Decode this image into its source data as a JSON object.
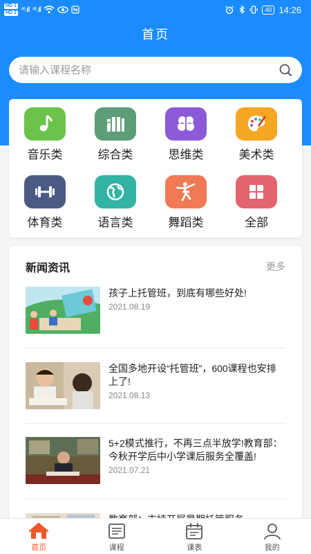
{
  "status_bar": {
    "hd1": "HD 1",
    "hd2": "HD 2",
    "signal1": "⁴⁶.ıll",
    "signal2": "⁴⁶.ıll",
    "battery": "40",
    "time": "14:26"
  },
  "header": {
    "title": "首页"
  },
  "search": {
    "placeholder": "请输入课程名称",
    "value": ""
  },
  "categories": [
    {
      "label": "音乐类",
      "color": "#6cc24a",
      "icon": "music-note-icon"
    },
    {
      "label": "综合类",
      "color": "#5d9e79",
      "icon": "books-icon"
    },
    {
      "label": "思维类",
      "color": "#8c5ad8",
      "icon": "brain-icon"
    },
    {
      "label": "美术类",
      "color": "#f5a623",
      "icon": "palette-icon"
    },
    {
      "label": "体育类",
      "color": "#4a5a82",
      "icon": "dumbbell-icon"
    },
    {
      "label": "语言类",
      "color": "#33b3a3",
      "icon": "globe-icon"
    },
    {
      "label": "舞蹈类",
      "color": "#f07a55",
      "icon": "dancer-icon"
    },
    {
      "label": "全部",
      "color": "#e2646e",
      "icon": "grid-icon"
    }
  ],
  "news": {
    "heading": "新闻资讯",
    "more": "更多",
    "items": [
      {
        "title": "孩子上托管班，到底有哪些好处!",
        "date": "2021.08.19"
      },
      {
        "title": "全国多地开设“托管班”，600课程也安排上了!",
        "date": "2021.08.13"
      },
      {
        "title": "5+2模式推行，不再三点半放学!教育部：今秋开学后中小学课后服务全覆盖!",
        "date": "2021.07.21"
      },
      {
        "title": "教育部：支持开展暑期托管服务",
        "date": ""
      }
    ]
  },
  "tabbar": {
    "active_color": "#f0582a",
    "tabs": [
      {
        "label": "首页",
        "icon": "home-icon"
      },
      {
        "label": "课程",
        "icon": "course-icon"
      },
      {
        "label": "课表",
        "icon": "calendar-icon"
      },
      {
        "label": "我的",
        "icon": "user-icon"
      }
    ]
  }
}
